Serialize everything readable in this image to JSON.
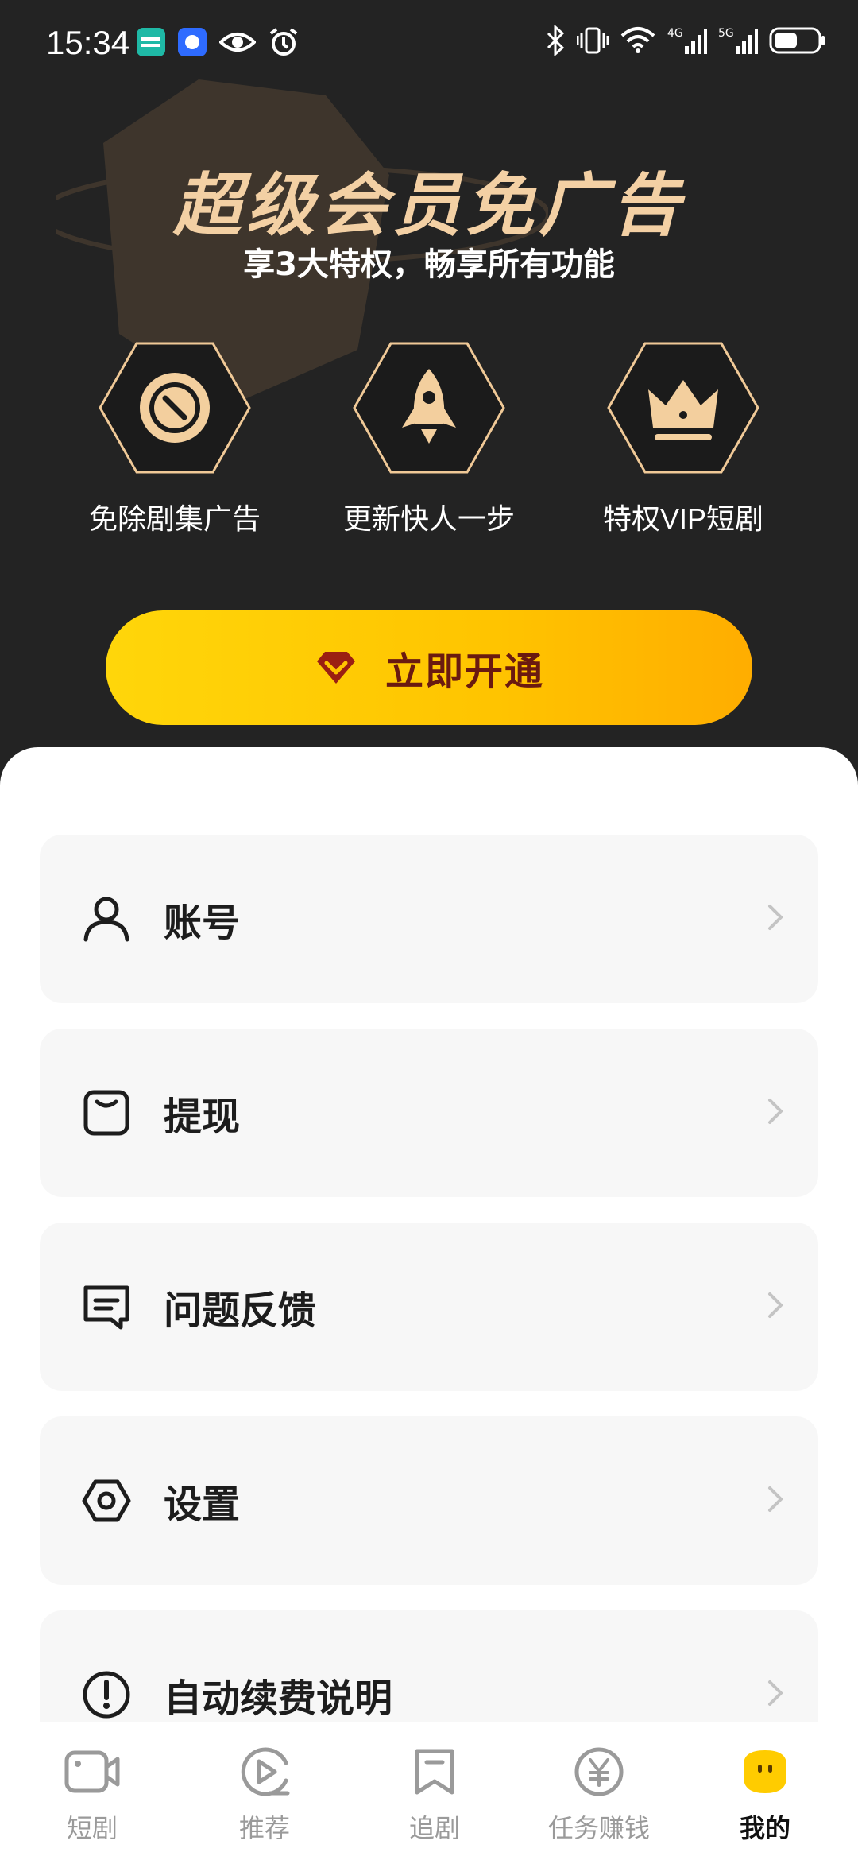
{
  "status_bar": {
    "time": "15:34",
    "left_icons": [
      "boss-app-icon",
      "app-icon",
      "eye-icon",
      "alarm-icon"
    ],
    "right_icons": [
      "bluetooth-icon",
      "vibrate-icon",
      "wifi-icon",
      "signal-4g-icon",
      "signal-5g-icon",
      "battery-icon"
    ]
  },
  "hero": {
    "title": "超级会员免广告",
    "subtitle": "享3大特权，畅享所有功能",
    "perks": [
      {
        "label": "免除剧集广告",
        "icon": "no-ads-icon"
      },
      {
        "label": "更新快人一步",
        "icon": "rocket-icon"
      },
      {
        "label": "特权VIP短剧",
        "icon": "crown-icon"
      }
    ],
    "cta_label": "立即开通"
  },
  "menu": [
    {
      "label": "账号",
      "icon": "user-icon"
    },
    {
      "label": "提现",
      "icon": "wallet-icon"
    },
    {
      "label": "问题反馈",
      "icon": "feedback-icon"
    },
    {
      "label": "设置",
      "icon": "settings-icon"
    },
    {
      "label": "自动续费说明",
      "icon": "info-icon"
    }
  ],
  "tabs": [
    {
      "label": "短剧",
      "icon": "video-camera-icon",
      "active": false
    },
    {
      "label": "推荐",
      "icon": "play-circle-icon",
      "active": false
    },
    {
      "label": "追剧",
      "icon": "bookmark-icon",
      "active": false
    },
    {
      "label": "任务赚钱",
      "icon": "yuan-coin-icon",
      "active": false
    },
    {
      "label": "我的",
      "icon": "profile-face-icon",
      "active": true
    }
  ],
  "colors": {
    "hero_bg": "#232323",
    "gold_title": "#f3d0a4",
    "cta_yellow": "#ffc400",
    "cta_text": "#6a1a10",
    "menu_bg": "#f7f7f7",
    "active_tab": "#ffcc00"
  }
}
